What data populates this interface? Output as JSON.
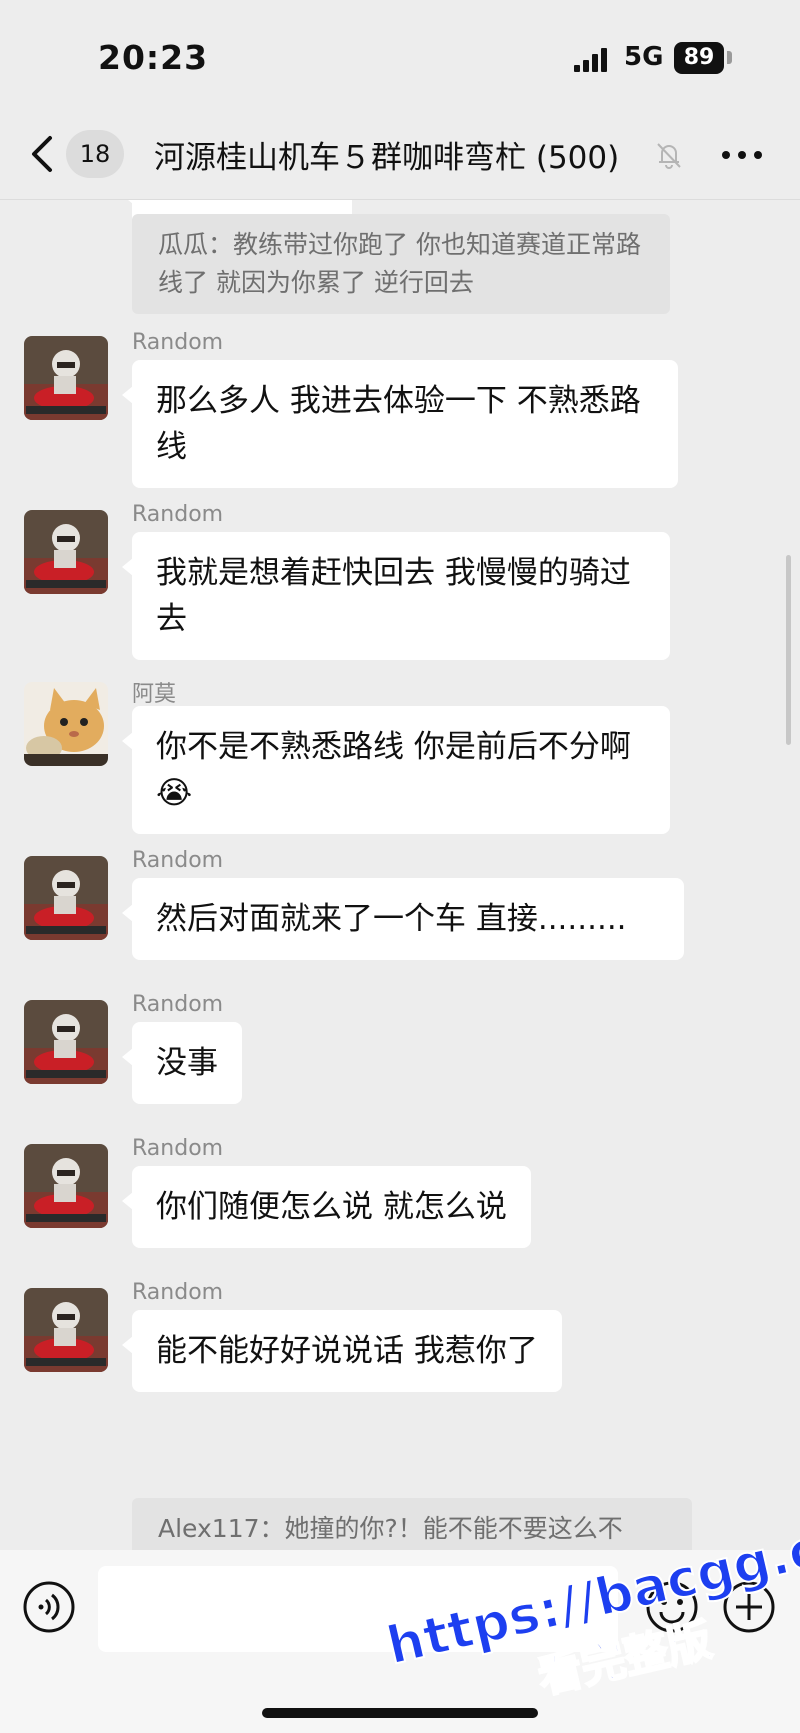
{
  "status_bar": {
    "time": "20:23",
    "network": "5G",
    "battery": "89"
  },
  "title_bar": {
    "unread_count": "18",
    "title": "河源桂山机车５群咖啡弯杧 (500)"
  },
  "chat": {
    "top_quote": "瓜瓜：教练带过你跑了 你也知道赛道正常路线了 就因为你累了 逆行回去",
    "messages": [
      {
        "sender": "Random",
        "text": "那么多人 我进去体验一下 不熟悉路线",
        "avatar": "motorcycle-rider"
      },
      {
        "sender": "Random",
        "text": "我就是想着赶快回去 我慢慢的骑过去",
        "avatar": "motorcycle-rider"
      },
      {
        "sender": "阿莫",
        "text": "你不是不熟悉路线 你是前后不分啊",
        "emoji": "😭",
        "avatar": "cat"
      },
      {
        "sender": "Random",
        "text": "然后对面就来了一个车 直接.........",
        "avatar": "motorcycle-rider"
      },
      {
        "sender": "Random",
        "text": "没事",
        "avatar": "motorcycle-rider"
      },
      {
        "sender": "Random",
        "text": "你们随便怎么说 就怎么说",
        "avatar": "motorcycle-rider"
      },
      {
        "sender": "Random",
        "text": "能不能好好说说话 我惹你了",
        "avatar": "motorcycle-rider"
      }
    ],
    "bottom_quote": "Alex117：她撞的你?！能不能不要这么不"
  },
  "input_bar": {
    "placeholder": ""
  },
  "watermark": {
    "line1": "https://bacgg.com",
    "line2": "看完整版"
  },
  "icons": {
    "back": "chevron-left-icon",
    "mute": "bell-slash-icon",
    "more": "ellipsis-icon",
    "voice": "voice-icon",
    "emoji": "emoji-icon",
    "plus": "plus-icon"
  },
  "colors": {
    "background": "#ededed",
    "bubble": "#ffffff",
    "quote": "#e3e3e3",
    "watermark": "#1d3ff0"
  }
}
